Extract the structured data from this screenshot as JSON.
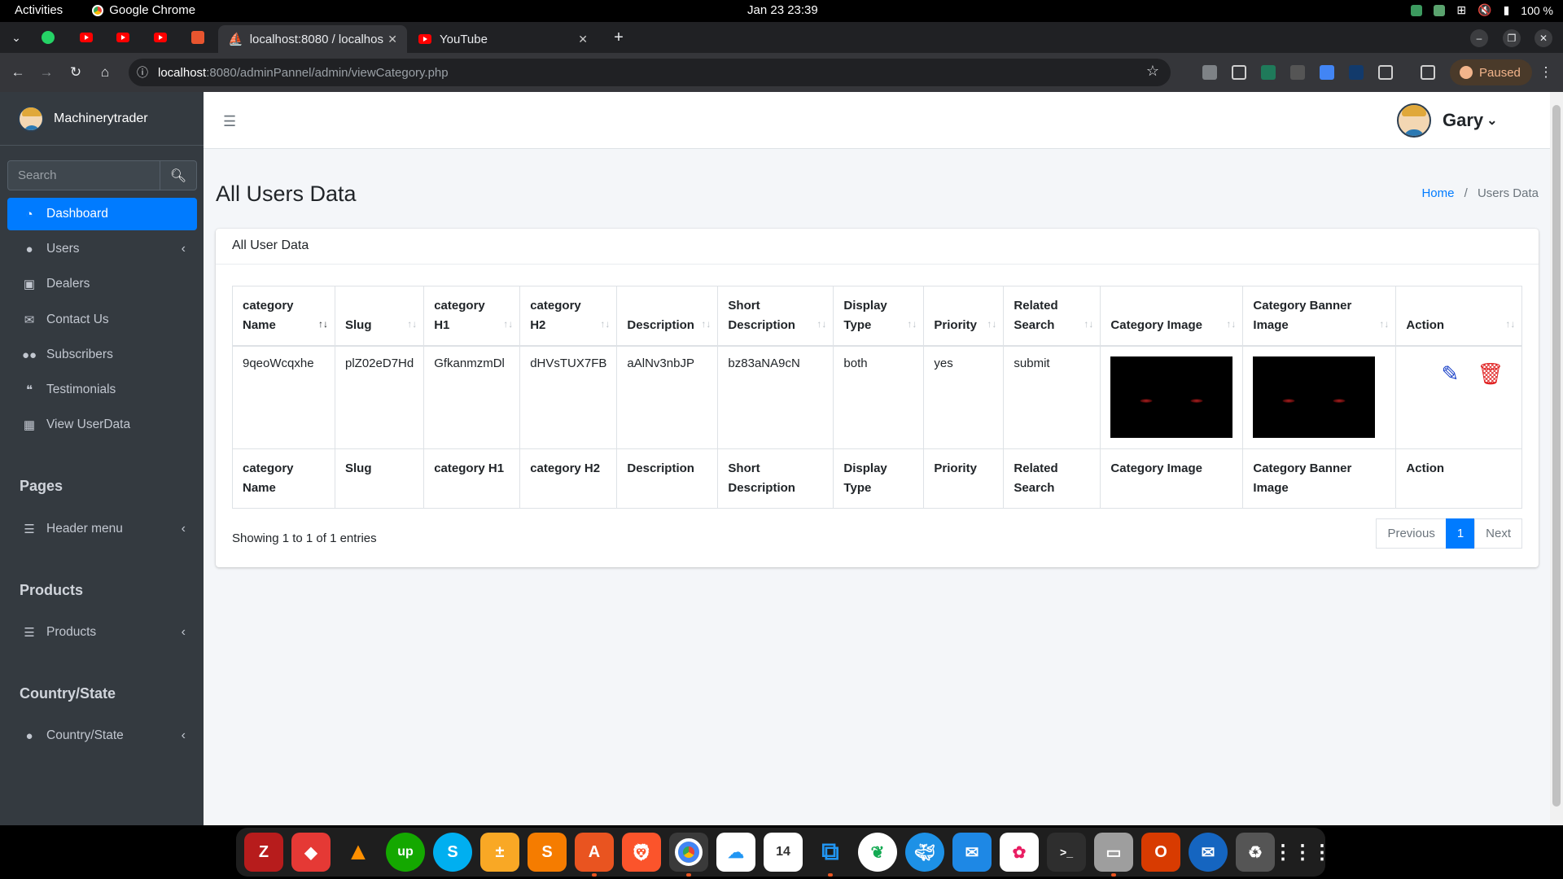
{
  "system": {
    "activities": "Activities",
    "app_name": "Google Chrome",
    "clock": "Jan 23  23:39",
    "battery": "100 %"
  },
  "browser": {
    "tabs": [
      {
        "title": "localhost:8080 / localhos",
        "active": true
      },
      {
        "title": "YouTube",
        "active": false
      }
    ],
    "url_host": "localhost",
    "url_path": ":8080/adminPannel/admin/viewCategory.php",
    "paused_label": "Paused"
  },
  "sidebar": {
    "brand": "Machinerytrader",
    "search_placeholder": "Search",
    "items": [
      {
        "label": "Dashboard",
        "icon": "gauge-icon",
        "active": true
      },
      {
        "label": "Users",
        "icon": "user-icon",
        "chevron": true
      },
      {
        "label": "Dealers",
        "icon": "id-badge-icon"
      },
      {
        "label": "Contact Us",
        "icon": "envelope-icon"
      },
      {
        "label": "Subscribers",
        "icon": "users-icon"
      },
      {
        "label": "Testimonials",
        "icon": "quote-icon"
      },
      {
        "label": "View UserData",
        "icon": "building-icon"
      }
    ],
    "sections": [
      {
        "header": "Pages",
        "item": "Header menu"
      },
      {
        "header": "Products",
        "item": "Products"
      },
      {
        "header": "Country/State",
        "item": "Country/State"
      }
    ]
  },
  "header": {
    "user_name": "Gary"
  },
  "content": {
    "title": "All Users Data",
    "breadcrumb_home": "Home",
    "breadcrumb_current": "Users Data",
    "card_title": "All User Data",
    "columns": [
      "category Name",
      "Slug",
      "category H1",
      "category H2",
      "Description",
      "Short Description",
      "Display Type",
      "Priority",
      "Related Search",
      "Category Image",
      "Category Banner Image",
      "Action"
    ],
    "rows": [
      {
        "name": "9qeoWcqxhe",
        "slug": "plZ02eD7Hd",
        "h1": "GfkanmzmDl",
        "h2": "dHVsTUX7FB",
        "description": "aAlNv3nbJP",
        "short_description": "bz83aNA9cN",
        "display_type": "both",
        "priority": "yes",
        "related_search": "submit"
      }
    ],
    "showing": "Showing 1 to 1 of 1 entries",
    "pager": {
      "prev": "Previous",
      "current": "1",
      "next": "Next"
    }
  },
  "colors": {
    "sidebar_bg": "#343a40",
    "primary": "#007bff",
    "delete": "#dc3545"
  }
}
